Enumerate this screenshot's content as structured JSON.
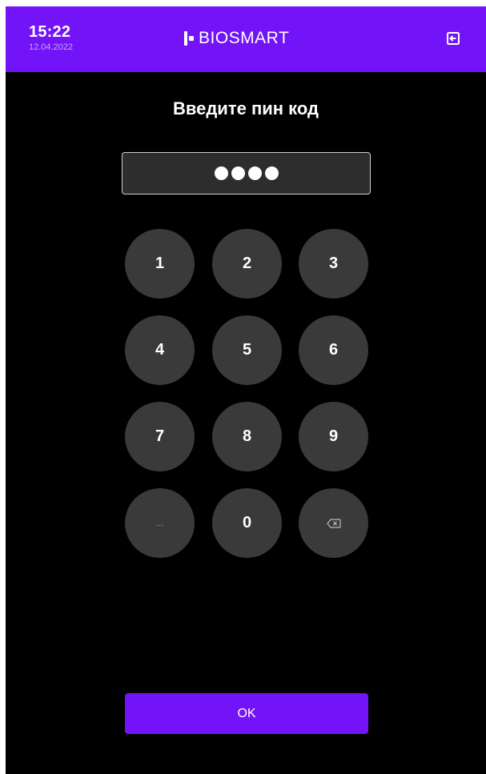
{
  "status_bar": {
    "time": "15:22",
    "date": "12.04.2022"
  },
  "brand": {
    "logo_text": "BIOSMART"
  },
  "icons": {
    "exit": "exit-icon",
    "backspace": "backspace-icon"
  },
  "prompt": {
    "title": "Введите пин код"
  },
  "pin": {
    "entered_digits": 4
  },
  "keypad": {
    "keys": [
      "1",
      "2",
      "3",
      "4",
      "5",
      "6",
      "7",
      "8",
      "9",
      "...",
      "0",
      "⌫"
    ]
  },
  "actions": {
    "ok_label": "OK"
  },
  "colors": {
    "accent": "#7313f7",
    "background": "#000000",
    "key_fill": "#3a3a3a",
    "field_fill": "#2d2d2d"
  }
}
